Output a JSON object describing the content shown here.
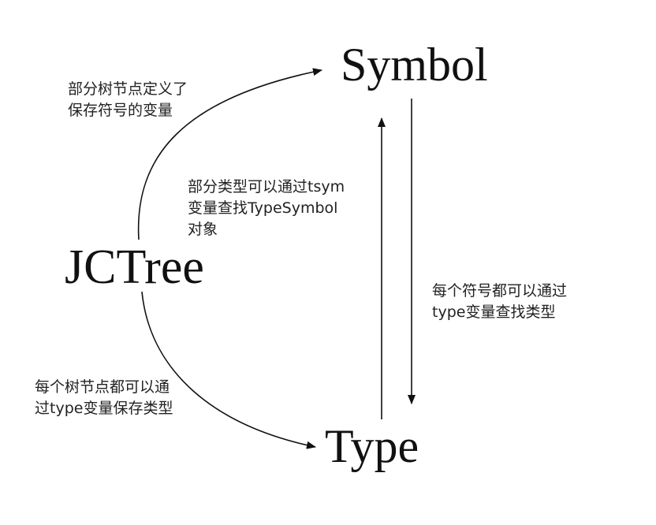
{
  "nodes": {
    "symbol": "Symbol",
    "jctree": "JCTree",
    "type": "Type"
  },
  "notes": {
    "tree_to_symbol": [
      "部分树节点定义了",
      "保存符号的变量"
    ],
    "type_to_symbol": [
      "部分类型可以通过tsym",
      "变量查找TypeSymbol",
      "对象"
    ],
    "symbol_to_type": [
      "每个符号都可以通过",
      "type变量查找类型"
    ],
    "tree_to_type": [
      "每个树节点都可以通",
      "过type变量保存类型"
    ]
  },
  "edges": [
    {
      "from": "JCTree",
      "to": "Symbol",
      "label": "tree_to_symbol"
    },
    {
      "from": "Type",
      "to": "Symbol",
      "label": "type_to_symbol"
    },
    {
      "from": "Symbol",
      "to": "Type",
      "label": "symbol_to_type"
    },
    {
      "from": "JCTree",
      "to": "Type",
      "label": "tree_to_type"
    }
  ],
  "colors": {
    "line": "#111111",
    "text": "#222222",
    "background": "#ffffff"
  }
}
